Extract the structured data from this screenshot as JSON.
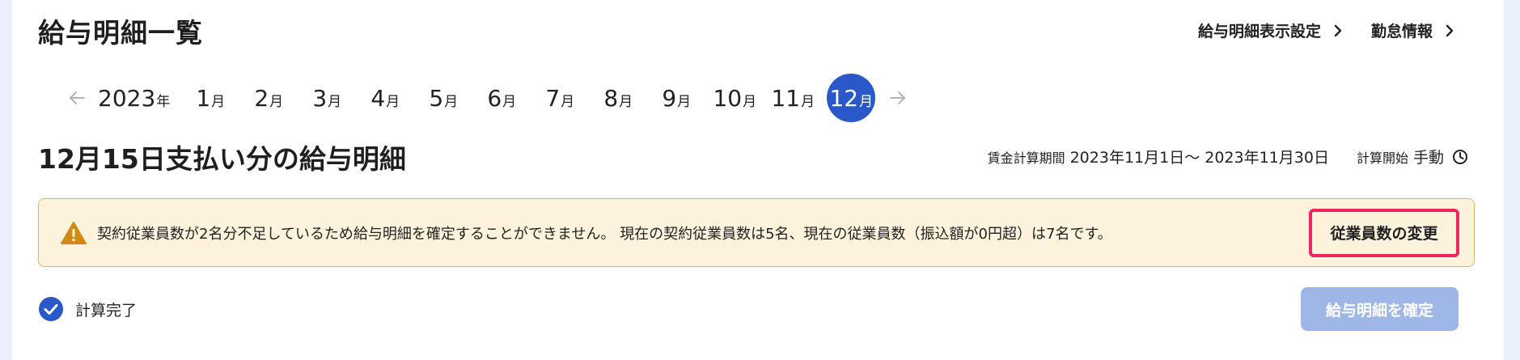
{
  "page": {
    "title": "給与明細一覧"
  },
  "header_links": [
    {
      "label": "給与明細表示設定",
      "icon": "chevron-right-icon"
    },
    {
      "label": "勤怠情報",
      "icon": "chevron-right-icon"
    }
  ],
  "month_nav": {
    "year": "2023",
    "year_unit": "年",
    "month_unit": "月",
    "months": [
      "1",
      "2",
      "3",
      "4",
      "5",
      "6",
      "7",
      "8",
      "9",
      "10",
      "11",
      "12"
    ],
    "selected": "12",
    "prev_icon": "arrow-left-icon",
    "next_icon": "arrow-right-icon"
  },
  "payslip": {
    "title": "12月15日支払い分の給与明細",
    "period_label": "賃金計算期間",
    "period_value": "2023年11月1日～ 2023年11月30日",
    "calc_start_label": "計算開始",
    "calc_start_value": "手動",
    "calc_start_icon": "clock-icon"
  },
  "warning": {
    "icon": "warning-icon",
    "message": "契約従業員数が2名分不足しているため給与明細を確定することができません。 現在の契約従業員数は5名、現在の従業員数（振込額が0円超）は7名です。",
    "action_label": "従業員数の変更"
  },
  "status": {
    "icon": "check-circle-icon",
    "label": "計算完了"
  },
  "confirm_button": {
    "label": "給与明細を確定",
    "disabled": true
  },
  "colors": {
    "accent": "#2a58c9",
    "warning_bg": "#fdf3dd",
    "warning_border": "#d9b56a",
    "warning_icon": "#d08a12",
    "highlight": "#f0245e",
    "disabled_button": "#9fb7e6",
    "page_bg": "#eaf0fb"
  }
}
